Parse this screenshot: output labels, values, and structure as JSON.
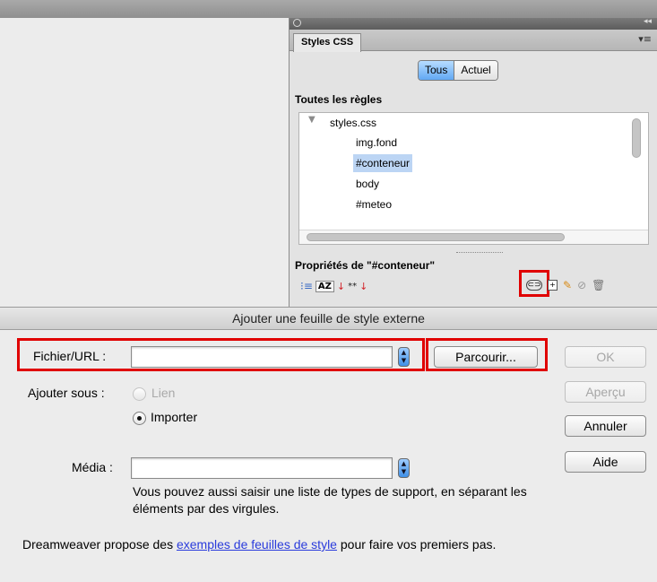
{
  "css_panel": {
    "tab_label": "Styles CSS",
    "collapse_glyph": "◂◂",
    "menu_glyph": "▾≡",
    "segment": {
      "all_label": "Tous",
      "current_label": "Actuel",
      "selected": "Tous"
    },
    "rules_heading": "Toutes les règles",
    "rules": [
      {
        "label": "styles.css",
        "level": 0,
        "expanded": true
      },
      {
        "label": "img.fond",
        "level": 1
      },
      {
        "label": "#conteneur",
        "level": 1,
        "selected": true
      },
      {
        "label": "body",
        "level": 1
      },
      {
        "label": "#meteo",
        "level": 1
      }
    ],
    "properties_heading": "Propriétés de \"#conteneur\"",
    "toolbar_left": {
      "category_icon": "category-view-icon",
      "az_label": "AZ",
      "set_props_icon": "set-properties-icon"
    },
    "toolbar_right_icons": [
      "attach-stylesheet-icon",
      "new-css-rule-icon",
      "edit-style-icon",
      "disable-property-icon",
      "delete-icon"
    ]
  },
  "dialog": {
    "title": "Ajouter une feuille de style externe",
    "file_label": "Fichier/URL :",
    "file_value": "",
    "browse_label": "Parcourir...",
    "add_as_label": "Ajouter sous :",
    "radio_link_label": "Lien",
    "radio_import_label": "Importer",
    "selected_option": "Importer",
    "media_label": "Média :",
    "media_value": "",
    "hint_text": "Vous pouvez aussi saisir une liste de types de support, en séparant les éléments par des virgules.",
    "footer_prefix": "Dreamweaver propose des ",
    "footer_link": "exemples de feuilles de style",
    "footer_suffix": " pour faire vos premiers pas.",
    "buttons": {
      "ok": "OK",
      "preview": "Aperçu",
      "cancel": "Annuler",
      "help": "Aide"
    }
  },
  "colors": {
    "highlight_red": "#e00000",
    "selection_blue": "#bcd5f4",
    "link_blue": "#2a3bdc",
    "segment_active": "#62a8f3"
  }
}
